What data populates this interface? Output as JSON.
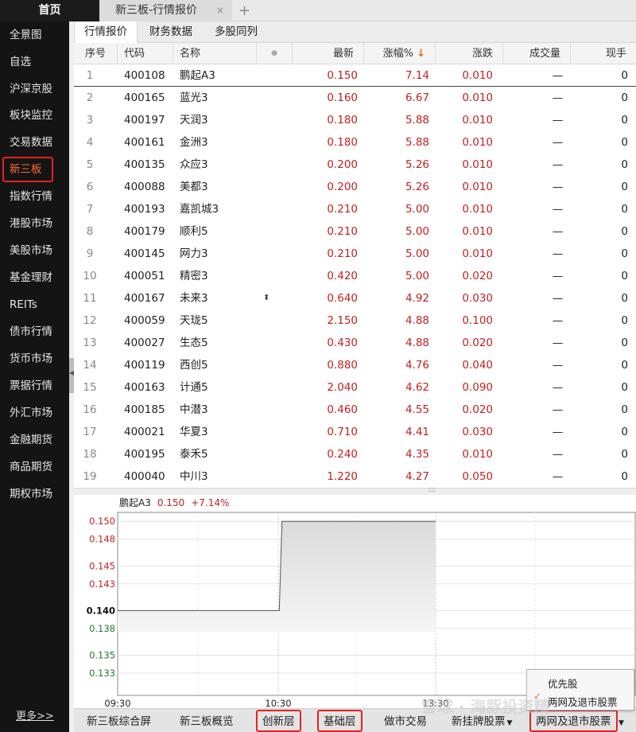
{
  "tabs": {
    "home": "首页",
    "active": "新三板-行情报价",
    "close": "×",
    "plus": "+"
  },
  "sidebar": {
    "items": [
      "全景图",
      "自选",
      "沪深京股",
      "板块监控",
      "交易数据",
      "新三板",
      "指数行情",
      "港股市场",
      "美股市场",
      "基金理财",
      "REITs",
      "债市行情",
      "货币市场",
      "票据行情",
      "外汇市场",
      "金融期货",
      "商品期货",
      "期权市场"
    ],
    "active_index": 5,
    "more": "更多>>"
  },
  "subtabs": [
    "行情报价",
    "财务数据",
    "多股同列"
  ],
  "table": {
    "headers": {
      "seq": "序号",
      "code": "代码",
      "name": "名称",
      "dot": "●",
      "price": "最新",
      "change_pct": "涨幅%",
      "sort": "↓",
      "change": "涨跌",
      "volume": "成交量",
      "last": "现手"
    },
    "rows": [
      [
        "1",
        "400108",
        "鹏起A3",
        "0.150",
        "7.14",
        "0.010",
        "—",
        "0"
      ],
      [
        "2",
        "400165",
        "蓝光3",
        "0.160",
        "6.67",
        "0.010",
        "—",
        "0"
      ],
      [
        "3",
        "400197",
        "天润3",
        "0.180",
        "5.88",
        "0.010",
        "—",
        "0"
      ],
      [
        "4",
        "400161",
        "金洲3",
        "0.180",
        "5.88",
        "0.010",
        "—",
        "0"
      ],
      [
        "5",
        "400135",
        "众应3",
        "0.200",
        "5.26",
        "0.010",
        "—",
        "0"
      ],
      [
        "6",
        "400088",
        "美都3",
        "0.200",
        "5.26",
        "0.010",
        "—",
        "0"
      ],
      [
        "7",
        "400193",
        "嘉凯城3",
        "0.210",
        "5.00",
        "0.010",
        "—",
        "0"
      ],
      [
        "8",
        "400179",
        "顺利5",
        "0.210",
        "5.00",
        "0.010",
        "—",
        "0"
      ],
      [
        "9",
        "400145",
        "网力3",
        "0.210",
        "5.00",
        "0.010",
        "—",
        "0"
      ],
      [
        "10",
        "400051",
        "精密3",
        "0.420",
        "5.00",
        "0.020",
        "—",
        "0"
      ],
      [
        "11",
        "400167",
        "未来3",
        "0.640",
        "4.92",
        "0.030",
        "—",
        "0"
      ],
      [
        "12",
        "400059",
        "天珑5",
        "2.150",
        "4.88",
        "0.100",
        "—",
        "0"
      ],
      [
        "13",
        "400027",
        "生态5",
        "0.430",
        "4.88",
        "0.020",
        "—",
        "0"
      ],
      [
        "14",
        "400119",
        "西创5",
        "0.880",
        "4.76",
        "0.040",
        "—",
        "0"
      ],
      [
        "15",
        "400163",
        "计通5",
        "2.040",
        "4.62",
        "0.090",
        "—",
        "0"
      ],
      [
        "16",
        "400185",
        "中潜3",
        "0.460",
        "4.55",
        "0.020",
        "—",
        "0"
      ],
      [
        "17",
        "400021",
        "华夏3",
        "0.710",
        "4.41",
        "0.030",
        "—",
        "0"
      ],
      [
        "18",
        "400195",
        "泰禾5",
        "0.240",
        "4.35",
        "0.010",
        "—",
        "0"
      ],
      [
        "19",
        "400040",
        "中川3",
        "1.220",
        "4.27",
        "0.050",
        "—",
        "0"
      ]
    ],
    "marker_row": 10,
    "marker": "⬍",
    "resizer": "::::"
  },
  "chart": {
    "stock": "鹏起A3",
    "price": "0.150",
    "change": "+7.14%"
  },
  "chart_data": {
    "type": "line",
    "title": "",
    "y_ticks": [
      "0.150",
      "0.148",
      "0.145",
      "0.143",
      "0.140",
      "0.138",
      "0.135",
      "0.133"
    ],
    "y_tick_values": [
      0.15,
      0.148,
      0.145,
      0.143,
      0.14,
      0.138,
      0.135,
      0.133
    ],
    "ylim": [
      0.1305,
      0.151
    ],
    "prev_close": 0.14,
    "x_ticks": [
      "09:30",
      "10:30",
      "13:30"
    ],
    "series": [
      {
        "x": [
          "09:30",
          "10:31",
          "10:32",
          "11:30"
        ],
        "values": [
          0.14,
          0.14,
          0.15,
          0.15
        ]
      }
    ],
    "grid": true
  },
  "bottombar": {
    "items": [
      "新三板综合屏",
      "新三板概览",
      "创新层",
      "基础层",
      "做市交易",
      "新挂牌股票",
      "两网及退市股票"
    ],
    "caret": "▼"
  },
  "popup": {
    "items": [
      "优先股",
      "两网及退市股票"
    ],
    "check": "✓"
  },
  "watermark": "雪球 · 海豚投资精",
  "colors": {
    "up": "#c21f1f",
    "down": "#1f7a2f",
    "accent": "#ff6a39",
    "highlight_box": "#e52222"
  }
}
